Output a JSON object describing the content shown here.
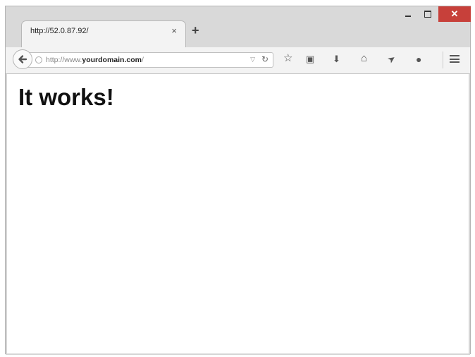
{
  "tab": {
    "title": "http://52.0.87.92/",
    "close_glyph": "×"
  },
  "new_tab_glyph": "+",
  "window_controls": {
    "close_glyph": "✕"
  },
  "address_bar": {
    "url_prefix": "http://www.",
    "url_domain": "yourdomain.com",
    "url_suffix": "/"
  },
  "toolbar": {
    "icons": [
      "back-arrow-icon",
      "globe-icon",
      "dropdown-icon",
      "reload-icon",
      "star-icon",
      "clipboard-icon",
      "download-icon",
      "home-icon",
      "send-icon",
      "chat-icon",
      "hamburger-menu-icon"
    ],
    "reload_glyph": "↻",
    "dropdown_glyph": "▽",
    "star_glyph": "☆",
    "clipboard_glyph": "▣",
    "download_glyph": "⬇",
    "home_glyph": "⌂",
    "send_glyph": "➤",
    "chat_glyph": "●"
  },
  "page": {
    "heading": "It works!"
  },
  "colors": {
    "close_button": "#c7403a",
    "chrome": "#d9d9d9",
    "toolbar": "#f3f3f3"
  }
}
